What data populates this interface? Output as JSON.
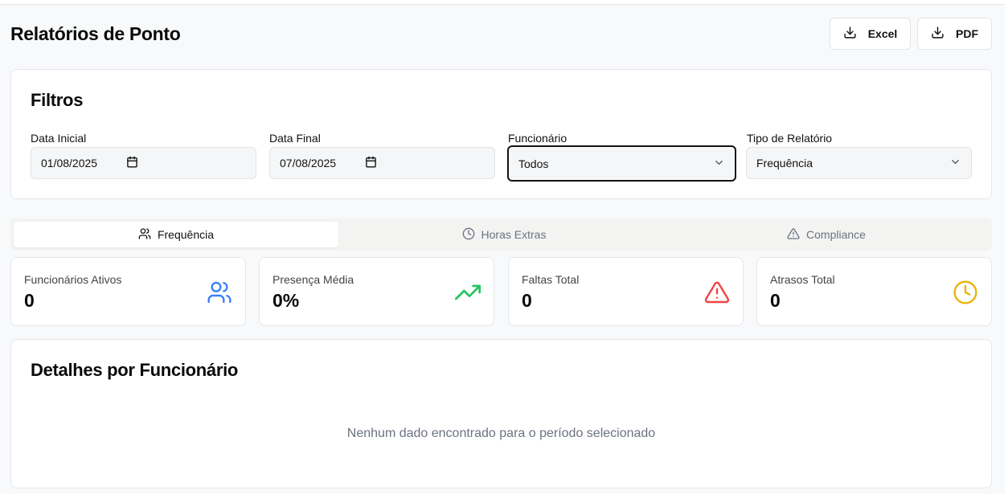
{
  "page": {
    "title": "Relatórios de Ponto"
  },
  "actions": {
    "excel_label": "Excel",
    "pdf_label": "PDF"
  },
  "filters": {
    "title": "Filtros",
    "fields": [
      {
        "label": "Data Inicial",
        "value": "01/08/2025",
        "icon": "calendar-icon"
      },
      {
        "label": "Data Final",
        "value": "07/08/2025",
        "icon": "calendar-icon"
      },
      {
        "label": "Funcionário",
        "value": "Todos",
        "icon": "chevron-down-icon"
      },
      {
        "label": "Tipo de Relatório",
        "value": "Frequência",
        "icon": "chevron-down-icon"
      }
    ]
  },
  "tabs": [
    {
      "label": "Frequência",
      "icon": "users-icon",
      "active": true
    },
    {
      "label": "Horas Extras",
      "icon": "clock-icon",
      "active": false
    },
    {
      "label": "Compliance",
      "icon": "warning-triangle-icon",
      "active": false
    }
  ],
  "stats": [
    {
      "label": "Funcionários Ativos",
      "value": "0",
      "icon": "users-icon",
      "color": "#3b82f6"
    },
    {
      "label": "Presença Média",
      "value": "0%",
      "icon": "trending-up-icon",
      "color": "#22c55e"
    },
    {
      "label": "Faltas Total",
      "value": "0",
      "icon": "alert-triangle-icon",
      "color": "#ef4444"
    },
    {
      "label": "Atrasos Total",
      "value": "0",
      "icon": "clock-icon",
      "color": "#eab308"
    }
  ],
  "details": {
    "title": "Detalhes por Funcionário",
    "empty_message": "Nenhum dado encontrado para o período selecionado"
  }
}
